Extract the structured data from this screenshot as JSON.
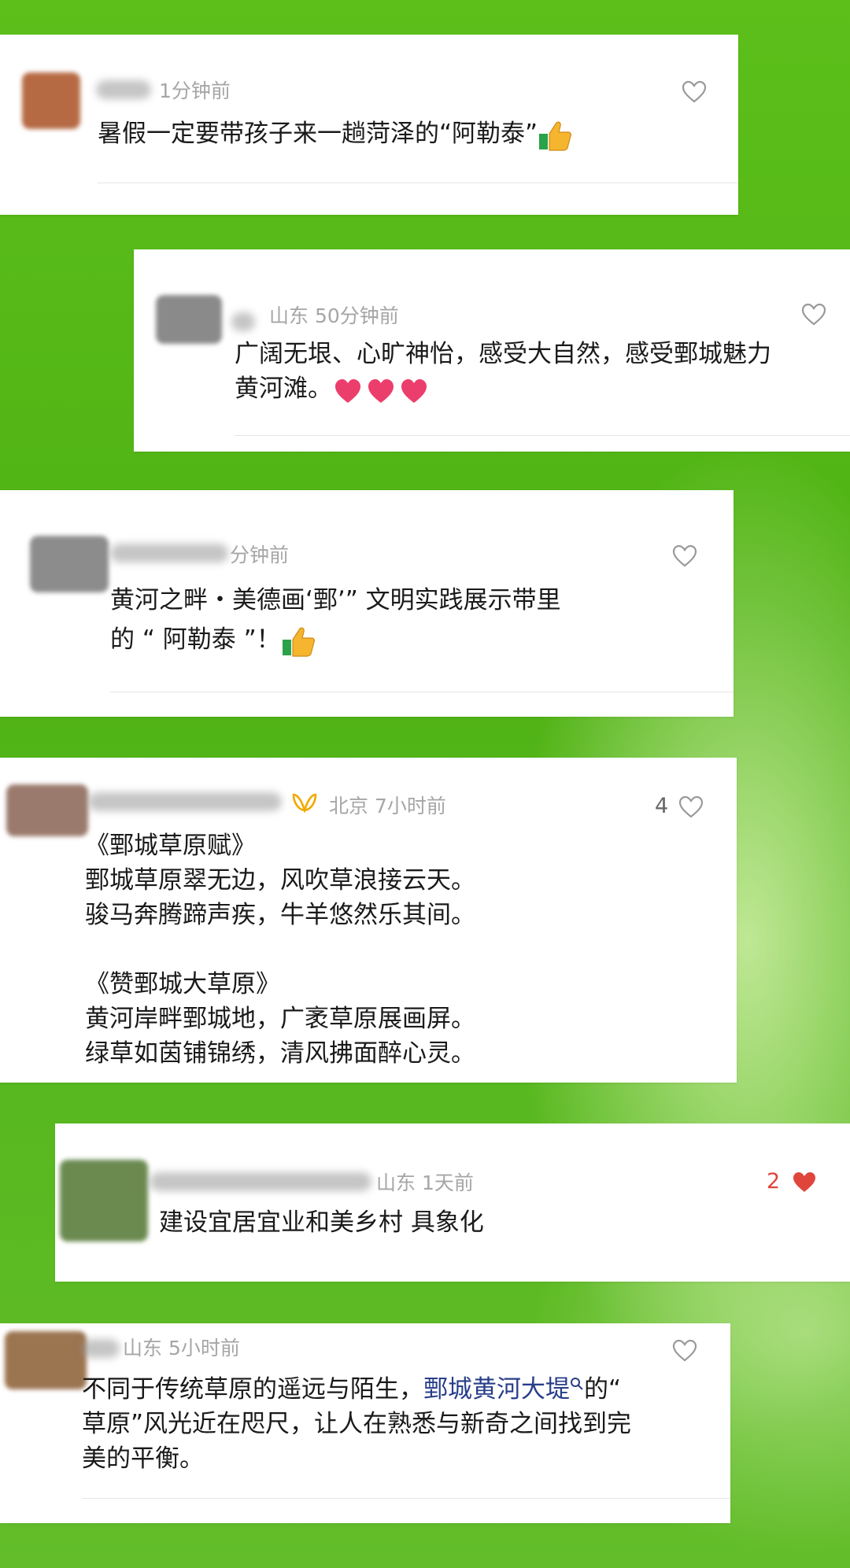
{
  "colors": {
    "background": "#52b516",
    "link": "#283e8a",
    "like_red": "#e0453c",
    "meta_gray": "#a6a6a6"
  },
  "comments": [
    {
      "meta": "1分钟前",
      "text": "暑假一定要带孩子来一趟菏泽的“阿勒泰”",
      "emoji": "thumbs-up",
      "likes": ""
    },
    {
      "meta": "山东 50分钟前",
      "lines": [
        "广阔无垠、心旷神怡，感受大自然，感受鄄城魅力",
        "黄河滩。"
      ],
      "emoji": "hearts",
      "likes": ""
    },
    {
      "meta": "分钟前",
      "lines": [
        "黄河之畔・美德画‘鄄’” 文明实践展示带里",
        "的 “ 阿勒泰 ”！"
      ],
      "emoji": "thumbs-up",
      "likes": ""
    },
    {
      "meta": "北京 7小时前",
      "lines": [
        "《鄄城草原赋》",
        "鄄城草原翠无边，风吹草浪接云天。",
        "骏马奔腾蹄声疾，牛羊悠然乐其间。",
        "",
        "《赞鄄城大草原》",
        "黄河岸畔鄄城地，广袤草原展画屏。",
        "绿草如茵铺锦绣，清风拂面醉心灵。"
      ],
      "likes": "4"
    },
    {
      "meta": "山东 1天前",
      "text": "建设宜居宜业和美乡村 具象化",
      "likes": "2"
    },
    {
      "meta": "山东 5小时前",
      "line1_a": "不同于传统草原的遥远与陌生，",
      "line1_link": "鄄城黄河大堤",
      "line1_b": "的“",
      "lines": [
        "草原”风光近在咫尺，让人在熟悉与新奇之间找到完",
        "美的平衡。"
      ],
      "likes": ""
    }
  ]
}
